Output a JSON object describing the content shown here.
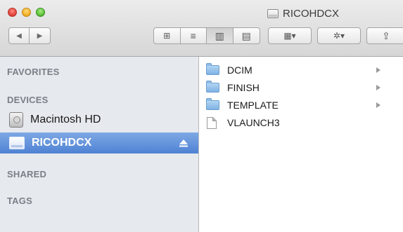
{
  "window": {
    "title": "RICOHDCX",
    "title_icon": "removable-volume-icon"
  },
  "toolbar": {
    "nav_back": "◀",
    "nav_forward": "▶",
    "view_icon_glyph": "⊞",
    "view_list_glyph": "≡",
    "view_column_glyph": "▥",
    "view_coverflow_glyph": "▤",
    "arrange_glyph": "▦▾",
    "action_glyph": "✲▾",
    "share_glyph": "⇪",
    "active_view": "column"
  },
  "sidebar": {
    "favorites_header": "FAVORITES",
    "devices_header": "DEVICES",
    "devices": [
      {
        "label": "Macintosh HD",
        "icon": "hard-disk-icon",
        "selected": false
      },
      {
        "label": "RICOHDCX",
        "icon": "removable-volume-icon",
        "selected": true,
        "eject": true
      }
    ],
    "shared_header": "SHARED",
    "tags_header": "TAGS"
  },
  "files": [
    {
      "name": "DCIM",
      "kind": "folder",
      "has_children": true
    },
    {
      "name": "FINISH",
      "kind": "folder",
      "has_children": true
    },
    {
      "name": "TEMPLATE",
      "kind": "folder",
      "has_children": true
    },
    {
      "name": "VLAUNCH3",
      "kind": "document",
      "has_children": false
    }
  ],
  "colors": {
    "selection_start": "#7fa9e4",
    "selection_end": "#4f82d4",
    "sidebar_bg": "#e6e9ee",
    "section_header": "#7a7f87",
    "folder_blue": "#7fb2e4"
  }
}
